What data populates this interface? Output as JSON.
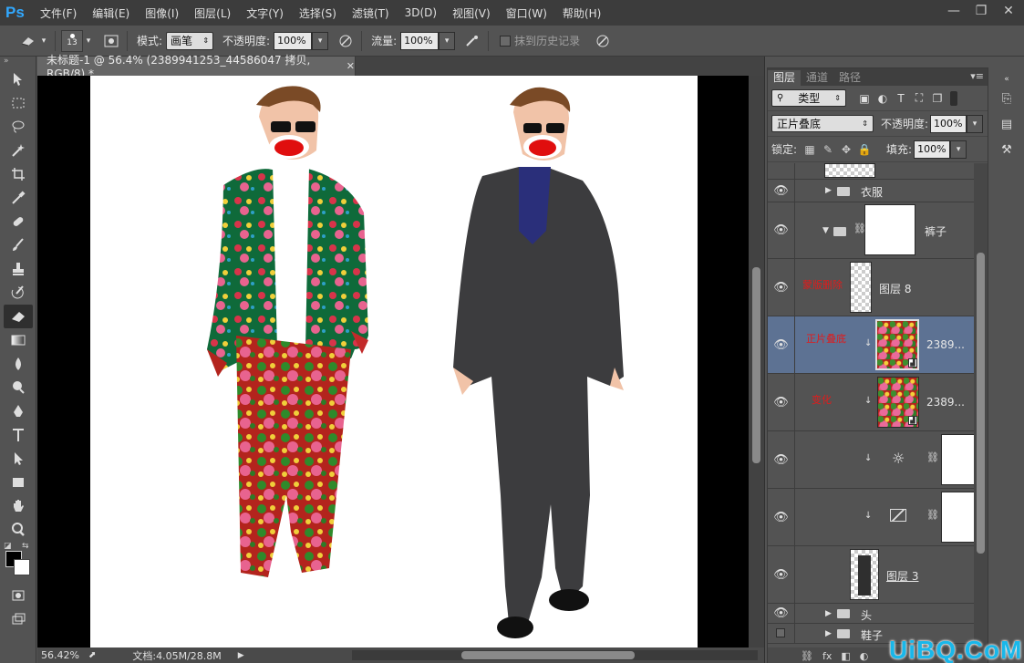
{
  "app": {
    "logo_text": "Ps",
    "menu": [
      "文件(F)",
      "编辑(E)",
      "图像(I)",
      "图层(L)",
      "文字(Y)",
      "选择(S)",
      "滤镜(T)",
      "3D(D)",
      "视图(V)",
      "窗口(W)",
      "帮助(H)"
    ],
    "window_controls": [
      "—",
      "❐",
      "✕"
    ]
  },
  "options": {
    "brush_size": "13",
    "mode_label": "模式:",
    "mode_value": "画笔",
    "opacity_label": "不透明度:",
    "opacity_value": "100%",
    "flow_label": "流量:",
    "flow_value": "100%",
    "erase_history_label": "抹到历史记录"
  },
  "document": {
    "tab_title": "未标题-1 @ 56.4% (2389941253_44586047 拷贝, RGB/8) *",
    "zoom": "56.42%",
    "doc_info": "文档:4.05M/28.8M"
  },
  "layers_panel": {
    "tabs": [
      "图层",
      "通道",
      "路径"
    ],
    "filter_value": "类型",
    "blend_mode": "正片叠底",
    "opacity_label": "不透明度:",
    "opacity_value": "100%",
    "lock_label": "锁定:",
    "fill_label": "填充:",
    "fill_value": "100%",
    "layers": [
      {
        "name": "",
        "visible": false
      },
      {
        "name": "衣服",
        "visible": true
      },
      {
        "name": "裤子",
        "visible": true
      },
      {
        "name": "图层 8",
        "visible": true,
        "annotation": "蒙版删除"
      },
      {
        "name": "2389...",
        "visible": true,
        "annotation": "正片叠底",
        "selected": true
      },
      {
        "name": "2389...",
        "visible": true,
        "annotation": "变化"
      },
      {
        "name": "",
        "visible": true,
        "adjustment_icon": "brightness-icon"
      },
      {
        "name": "",
        "visible": true,
        "adjustment_icon": "curves-icon"
      },
      {
        "name": "图层 3",
        "visible": true
      },
      {
        "name": "头",
        "visible": true
      },
      {
        "name": "鞋子",
        "visible": false
      }
    ],
    "footer_icons": [
      "⛓",
      "fx",
      "◧",
      "◐",
      "▬",
      "❏",
      "🗑"
    ]
  },
  "watermark": "UiBQ.CoM",
  "colors": {
    "accent": "#31a8ff",
    "selected_layer": "#5d7293",
    "annotation_red": "#e11b1b",
    "watermark": "#19b7ea"
  }
}
